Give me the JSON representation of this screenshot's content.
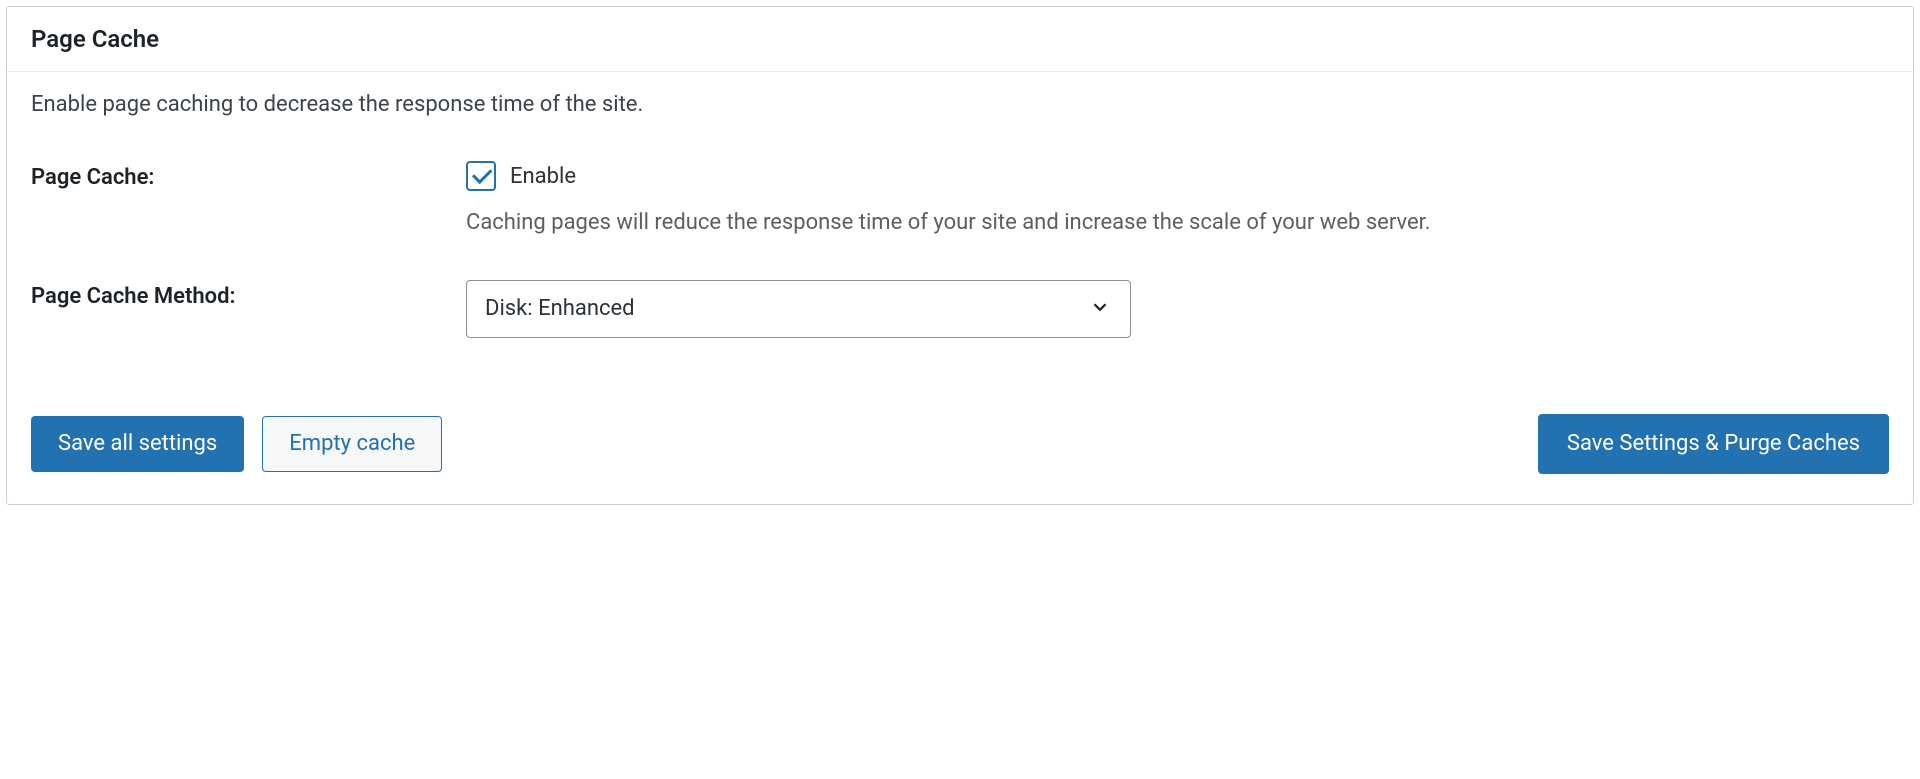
{
  "panel": {
    "title": "Page Cache",
    "description": "Enable page caching to decrease the response time of the site."
  },
  "pageCache": {
    "label": "Page Cache:",
    "checkbox_label": "Enable",
    "checked": true,
    "help": "Caching pages will reduce the response time of your site and increase the scale of your web server."
  },
  "method": {
    "label": "Page Cache Method:",
    "selected": "Disk: Enhanced"
  },
  "buttons": {
    "save_all": "Save all settings",
    "empty_cache": "Empty cache",
    "save_purge": "Save Settings & Purge Caches"
  }
}
